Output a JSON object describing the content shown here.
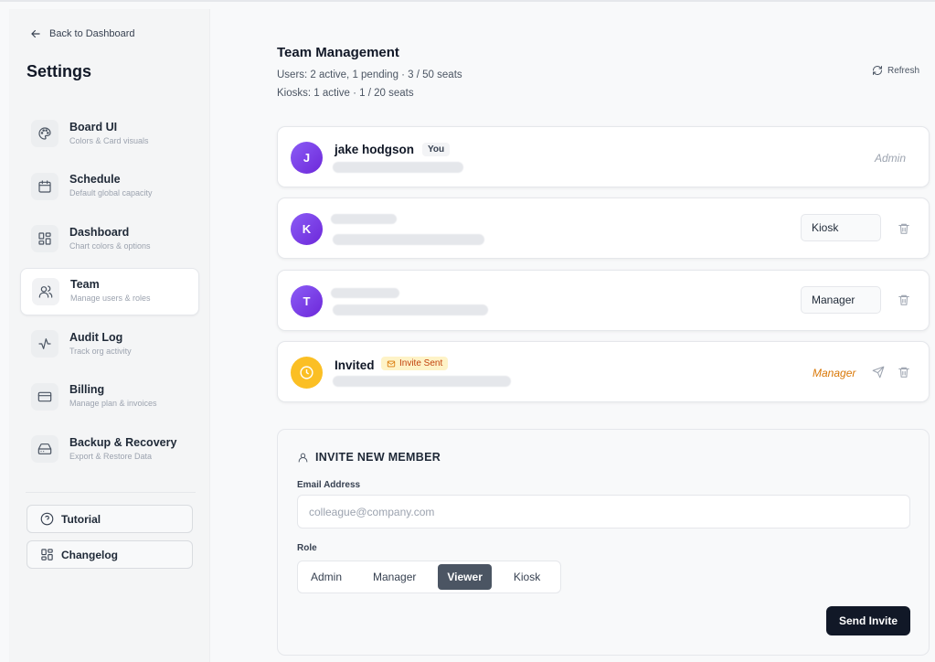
{
  "sidebar": {
    "back_label": "Back to Dashboard",
    "title": "Settings",
    "items": [
      {
        "label": "Board UI",
        "sub": "Colors & Card visuals",
        "icon": "palette-icon"
      },
      {
        "label": "Schedule",
        "sub": "Default global capacity",
        "icon": "calendar-icon"
      },
      {
        "label": "Dashboard",
        "sub": "Chart colors & options",
        "icon": "grid-icon"
      },
      {
        "label": "Team",
        "sub": "Manage users & roles",
        "icon": "users-icon",
        "active": true
      },
      {
        "label": "Audit Log",
        "sub": "Track org activity",
        "icon": "activity-icon"
      },
      {
        "label": "Billing",
        "sub": "Manage plan & invoices",
        "icon": "credit-card-icon"
      },
      {
        "label": "Backup & Recovery",
        "sub": "Export & Restore Data",
        "icon": "hard-drive-icon"
      }
    ],
    "tutorial_label": "Tutorial",
    "changelog_label": "Changelog"
  },
  "main": {
    "title": "Team Management",
    "users_stat": "Users: 2 active, 1 pending · 3 / 50 seats",
    "kiosks_stat": "Kiosks: 1 active · 1 / 20 seats",
    "refresh_label": "Refresh",
    "members": [
      {
        "initial": "J",
        "name": "jake hodgson",
        "badge": "You",
        "role": "Admin"
      },
      {
        "initial": "K",
        "role": "Kiosk"
      },
      {
        "initial": "T",
        "role": "Manager"
      },
      {
        "name": "Invited",
        "badge": "Invite Sent",
        "role": "Manager"
      }
    ]
  },
  "invite": {
    "header": "INVITE NEW MEMBER",
    "email_label": "Email Address",
    "email_placeholder": "colleague@company.com",
    "role_label": "Role",
    "roles": [
      "Admin",
      "Manager",
      "Viewer",
      "Kiosk"
    ],
    "selected_role": "Viewer",
    "send_label": "Send Invite"
  },
  "colors": {
    "accent_dark": "#111827",
    "avatar_purple": "#7c3aed",
    "pending_amber": "#fbbf24",
    "pending_text": "#c2410c"
  }
}
